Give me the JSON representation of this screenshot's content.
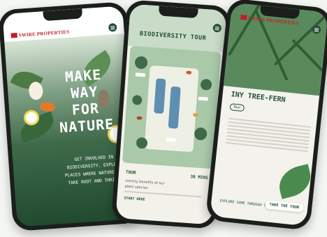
{
  "brand": {
    "name": "SWIRE PROPERTIES"
  },
  "phone1": {
    "headline": [
      "MAKE",
      "WAY",
      "FOR",
      "NATURE"
    ],
    "body": "GET INVOLVED IN BIODIVERSITY. EXPLORE PLACES WHERE NATURE CAN TAKE ROOT AND THRIVE."
  },
  "phone2": {
    "title": "BIODIVERSITY TOUR",
    "tour_label": "TOUR",
    "duration": "30 MINS",
    "desc_line1": "iversity benefits of our",
    "desc_line2": "plant species",
    "start": "START HERE"
  },
  "phone3": {
    "title": "INY TREE-FERN",
    "audio": "Tour",
    "explore": "EXPLORE SOME THROUGH YOUR LENS",
    "take_tour": "TAKE THE TOUR"
  },
  "colors": {
    "brand_red": "#c0202a",
    "forest_green": "#234d36"
  }
}
